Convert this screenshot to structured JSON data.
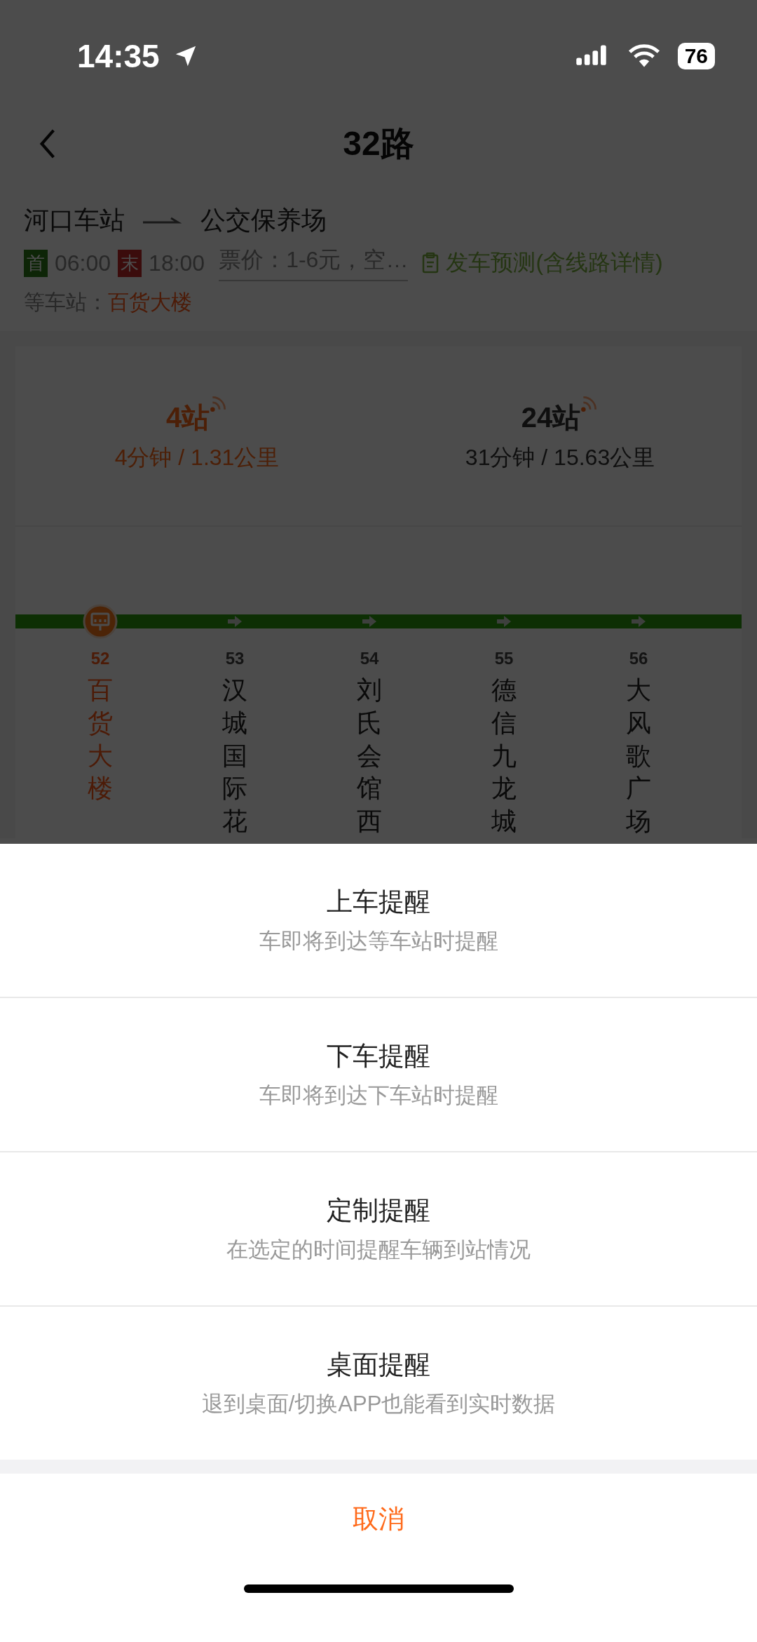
{
  "status_bar": {
    "time": "14:35",
    "battery": "76"
  },
  "nav": {
    "title": "32路"
  },
  "route": {
    "from": "河口车站",
    "to": "公交保养场",
    "first_label": "首",
    "first_time": "06:00",
    "last_label": "末",
    "last_time": "18:00",
    "fare": "票价：1-6元，空…",
    "forecast_link": "发车预测(含线路详情)",
    "wait_label": "等车站：",
    "wait_station": "百货大楼"
  },
  "arrivals": [
    {
      "stops": "4站",
      "detail": "4分钟 / 1.31公里",
      "selected": true
    },
    {
      "stops": "24站",
      "detail": "31分钟 / 15.63公里",
      "selected": false
    }
  ],
  "stations": [
    {
      "number": "52",
      "name": "百货大楼",
      "selected": true
    },
    {
      "number": "53",
      "name": "汉城国际花",
      "selected": false
    },
    {
      "number": "54",
      "name": "刘氏会馆西",
      "selected": false
    },
    {
      "number": "55",
      "name": "德信九龙城",
      "selected": false
    },
    {
      "number": "56",
      "name": "大风歌广场",
      "selected": false
    }
  ],
  "sheet": {
    "options": [
      {
        "title": "上车提醒",
        "subtitle": "车即将到达等车站时提醒"
      },
      {
        "title": "下车提醒",
        "subtitle": "车即将到达下车站时提醒"
      },
      {
        "title": "定制提醒",
        "subtitle": "在选定的时间提醒车辆到站情况"
      },
      {
        "title": "桌面提醒",
        "subtitle": "退到桌面/切换APP也能看到实时数据"
      }
    ],
    "cancel": "取消"
  }
}
